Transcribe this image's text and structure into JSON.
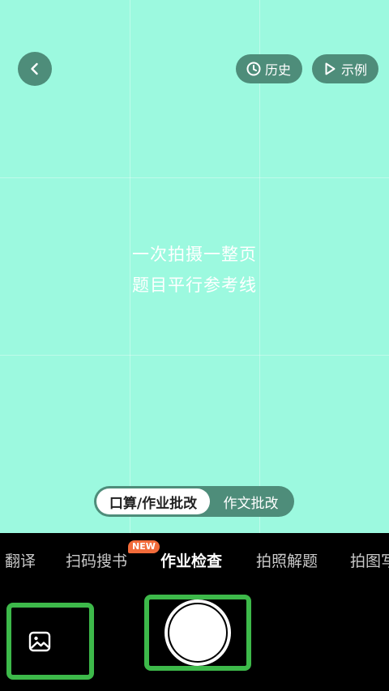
{
  "header": {
    "back_icon": "chevron-left-icon",
    "history_label": "历史",
    "history_icon": "clock-icon",
    "example_label": "示例",
    "example_icon": "play-icon"
  },
  "viewfinder": {
    "background": "#9cf9df",
    "hint_line1": "一次拍摄一整页",
    "hint_line2": "题目平行参考线"
  },
  "mode_switch": {
    "active_label": "口算/作业批改",
    "inactive_label": "作文批改"
  },
  "tabs": [
    {
      "label": "翻译",
      "active": false
    },
    {
      "label": "扫码搜书",
      "active": false,
      "badge": "NEW"
    },
    {
      "label": "作业检查",
      "active": true
    },
    {
      "label": "拍照解题",
      "active": false
    },
    {
      "label": "拍图写",
      "active": false
    }
  ],
  "controls": {
    "gallery_icon": "image-icon",
    "highlight_color": "#3db94a"
  }
}
